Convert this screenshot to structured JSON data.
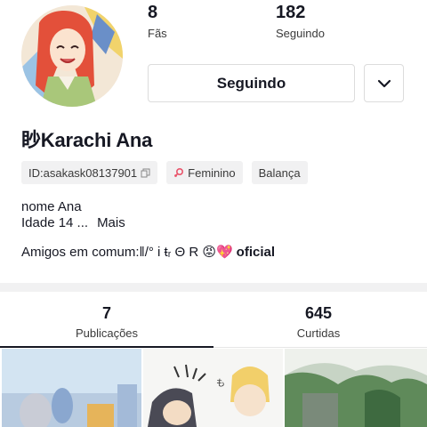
{
  "profile": {
    "fans_count": "8",
    "fans_label": "Fãs",
    "following_count": "182",
    "following_label": "Seguindo",
    "follow_button_label": "Seguindo",
    "display_name": "眇Karachi Ana",
    "id_tag": "ID:asakask08137901",
    "gender_tag": "Feminino",
    "zodiac_tag": "Balança",
    "bio_line1": "nome Ana",
    "bio_line2": "Idade 14 ...",
    "bio_more": "Mais",
    "mutual_prefix": "Amigos em comum:ǁ/° i ŧᵣ Θ R 😡💖",
    "mutual_suffix": "oficial"
  },
  "tabs": [
    {
      "count": "7",
      "label": "Publicações"
    },
    {
      "count": "645",
      "label": "Curtidas"
    }
  ],
  "icons": {
    "copy": "copy-icon",
    "gender": "female-symbol-icon",
    "dropdown": "chevron-down-icon"
  },
  "colors": {
    "gender_accent": "#e9546b",
    "text_primary": "#161823",
    "chip_bg": "#f1f1f2"
  }
}
